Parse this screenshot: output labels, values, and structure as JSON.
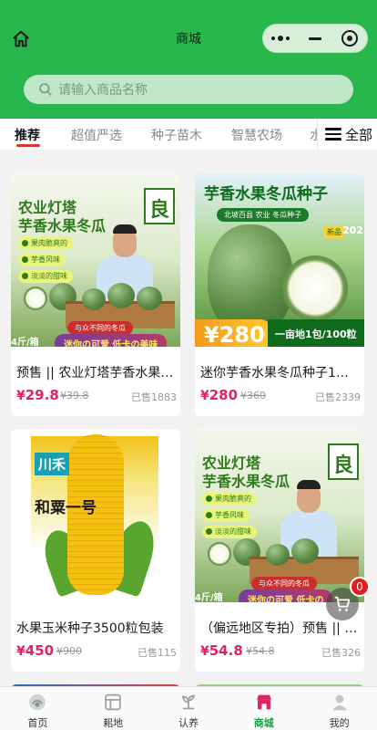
{
  "header": {
    "title": "商城",
    "search_placeholder": "请输入商品名称",
    "bg_color": "#27b74d"
  },
  "tabs": {
    "items": [
      {
        "label": "推荐",
        "active": true
      },
      {
        "label": "超值严选",
        "active": false
      },
      {
        "label": "种子苗木",
        "active": false
      },
      {
        "label": "智慧农场",
        "active": false
      },
      {
        "label": "水",
        "active": false
      }
    ],
    "all_label": "全部"
  },
  "products": [
    {
      "title": "预售 || 农业灯塔芋香水果冬瓜种子",
      "currency": "¥",
      "price": "29.8",
      "old_price": "¥39.8",
      "sold": "已售1883",
      "poster": {
        "headline_1": "农业灯塔",
        "headline_2": "芋香水果冬瓜",
        "logo": "良",
        "bullets": [
          "果肉脆爽的",
          "芋香风味",
          "淡淡的甜味"
        ],
        "red_banner": "与众不同的冬瓜",
        "bottom_banner": "迷你の可爱 低卡の美味",
        "corner": "4斤/箱"
      }
    },
    {
      "title": "迷你芋香水果冬瓜种子1包/100粒",
      "currency": "¥",
      "price": "280",
      "old_price": "¥360",
      "sold": "已售2339",
      "poster": {
        "headline": "芋香水果冬瓜种子",
        "subtitle": "北坡百县 农业 冬瓜种子",
        "year": "2025",
        "tag": "新品",
        "price_badge": "¥280",
        "bar_text": "一亩地1包/100粒"
      }
    },
    {
      "title": "水果玉米种子3500粒包装",
      "currency": "¥",
      "price": "450",
      "old_price": "¥900",
      "sold": "已售115",
      "poster": {
        "brand": "川禾",
        "variety": "和粟一号"
      }
    },
    {
      "title": "（偏远地区专拍）预售 || 农业灯塔芋香水果冬瓜",
      "currency": "¥",
      "price": "54.8",
      "old_price": "¥54.8",
      "sold": "已售326",
      "poster": {
        "headline_1": "农业灯塔",
        "headline_2": "芋香水果冬瓜",
        "logo": "良",
        "bullets": [
          "果肉脆爽的",
          "芋香风味",
          "淡淡的甜味"
        ],
        "red_banner": "与众不同的冬瓜",
        "bottom_banner": "迷你の可爱 低卡の",
        "corner": "4斤/箱"
      }
    }
  ],
  "cart": {
    "badge": "0"
  },
  "bottom_nav": {
    "items": [
      {
        "label": "首页",
        "icon": "home-icon",
        "active": false
      },
      {
        "label": "耜地",
        "icon": "field-icon",
        "active": false
      },
      {
        "label": "认养",
        "icon": "adopt-icon",
        "active": false
      },
      {
        "label": "商城",
        "icon": "shop-icon",
        "active": true
      },
      {
        "label": "我的",
        "icon": "user-icon",
        "active": false
      }
    ]
  },
  "colors": {
    "accent": "#1aa04a",
    "price": "#e0245e",
    "tab_indicator": "#e03131"
  }
}
